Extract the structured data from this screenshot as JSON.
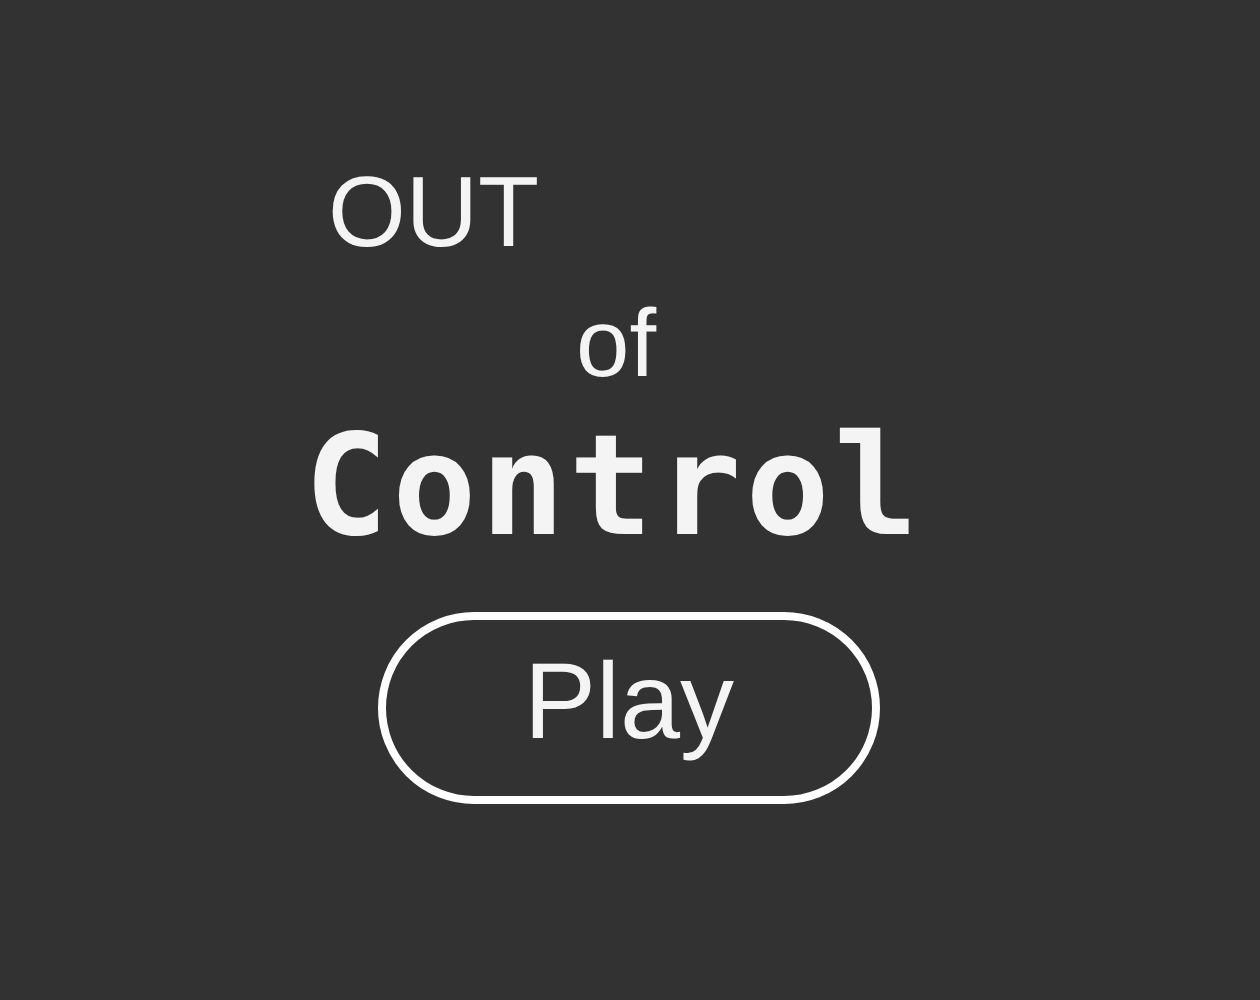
{
  "title": {
    "line_1": "OUT",
    "line_2": "of",
    "line_3": "Control"
  },
  "buttons": [
    {
      "label": "Play"
    }
  ]
}
